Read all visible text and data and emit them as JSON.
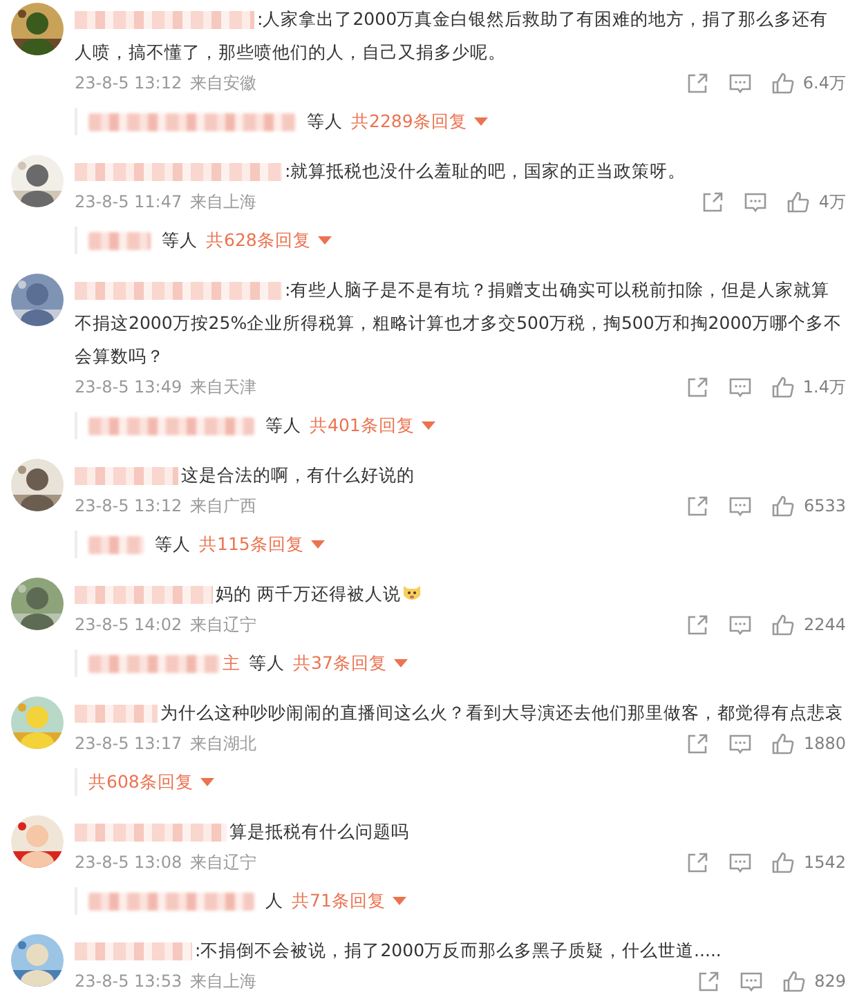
{
  "comments": [
    {
      "text": ":人家拿出了2000万真金白银然后救助了有困难的地方，捐了那么多还有人喷，搞不懂了，那些喷他们的人，自己又捐多少呢。",
      "has_emoji": false,
      "time": "23-8-5 13:12",
      "location": "来自安徽",
      "likes": "6.4万",
      "replies": {
        "names_blurred": true,
        "others": "等人",
        "count": "共2289条回复"
      }
    },
    {
      "text": ":就算抵税也没什么羞耻的吧，国家的正当政策呀。",
      "has_emoji": false,
      "time": "23-8-5 11:47",
      "location": "来自上海",
      "likes": "4万",
      "replies": {
        "names_blurred": true,
        "others": "等人",
        "count": "共628条回复"
      }
    },
    {
      "text": ":有些人脑子是不是有坑？捐赠支出确实可以税前扣除，但是人家就算不捐这2000万按25%企业所得税算，粗略计算也才多交500万税，掏500万和掏2000万哪个多不会算数吗？",
      "has_emoji": false,
      "time": "23-8-5 13:49",
      "location": "来自天津",
      "likes": "1.4万",
      "replies": {
        "names_blurred": true,
        "others": "等人",
        "count": "共401条回复"
      }
    },
    {
      "text": "这是合法的啊，有什么好说的",
      "has_emoji": false,
      "time": "23-8-5 13:12",
      "location": "来自广西",
      "likes": "6533",
      "replies": {
        "names_blurred": true,
        "others": "等人",
        "count": "共115条回复"
      }
    },
    {
      "text": "妈的 两千万还得被人说",
      "has_emoji": true,
      "time": "23-8-5 14:02",
      "location": "来自辽宁",
      "likes": "2244",
      "replies": {
        "names_blurred": true,
        "name_tail": "主",
        "others": "等人",
        "count": "共37条回复"
      }
    },
    {
      "text": "为什么这种吵吵闹闹的直播间这么火？看到大导演还去他们那里做客，都觉得有点悲哀",
      "has_emoji": false,
      "time": "23-8-5 13:17",
      "location": "来自湖北",
      "likes": "1880",
      "replies": {
        "names_blurred": false,
        "count": "共608条回复"
      }
    },
    {
      "text": "算是抵税有什么问题吗",
      "has_emoji": false,
      "time": "23-8-5 13:08",
      "location": "来自辽宁",
      "likes": "1542",
      "replies": {
        "names_blurred": true,
        "others": "人",
        "count": "共71条回复"
      }
    },
    {
      "text": ":不捐倒不会被说，捐了2000万反而那么多黑子质疑，什么世道.....",
      "has_emoji": false,
      "time": "23-8-5 13:53",
      "location": "来自上海",
      "likes": "829"
    }
  ]
}
